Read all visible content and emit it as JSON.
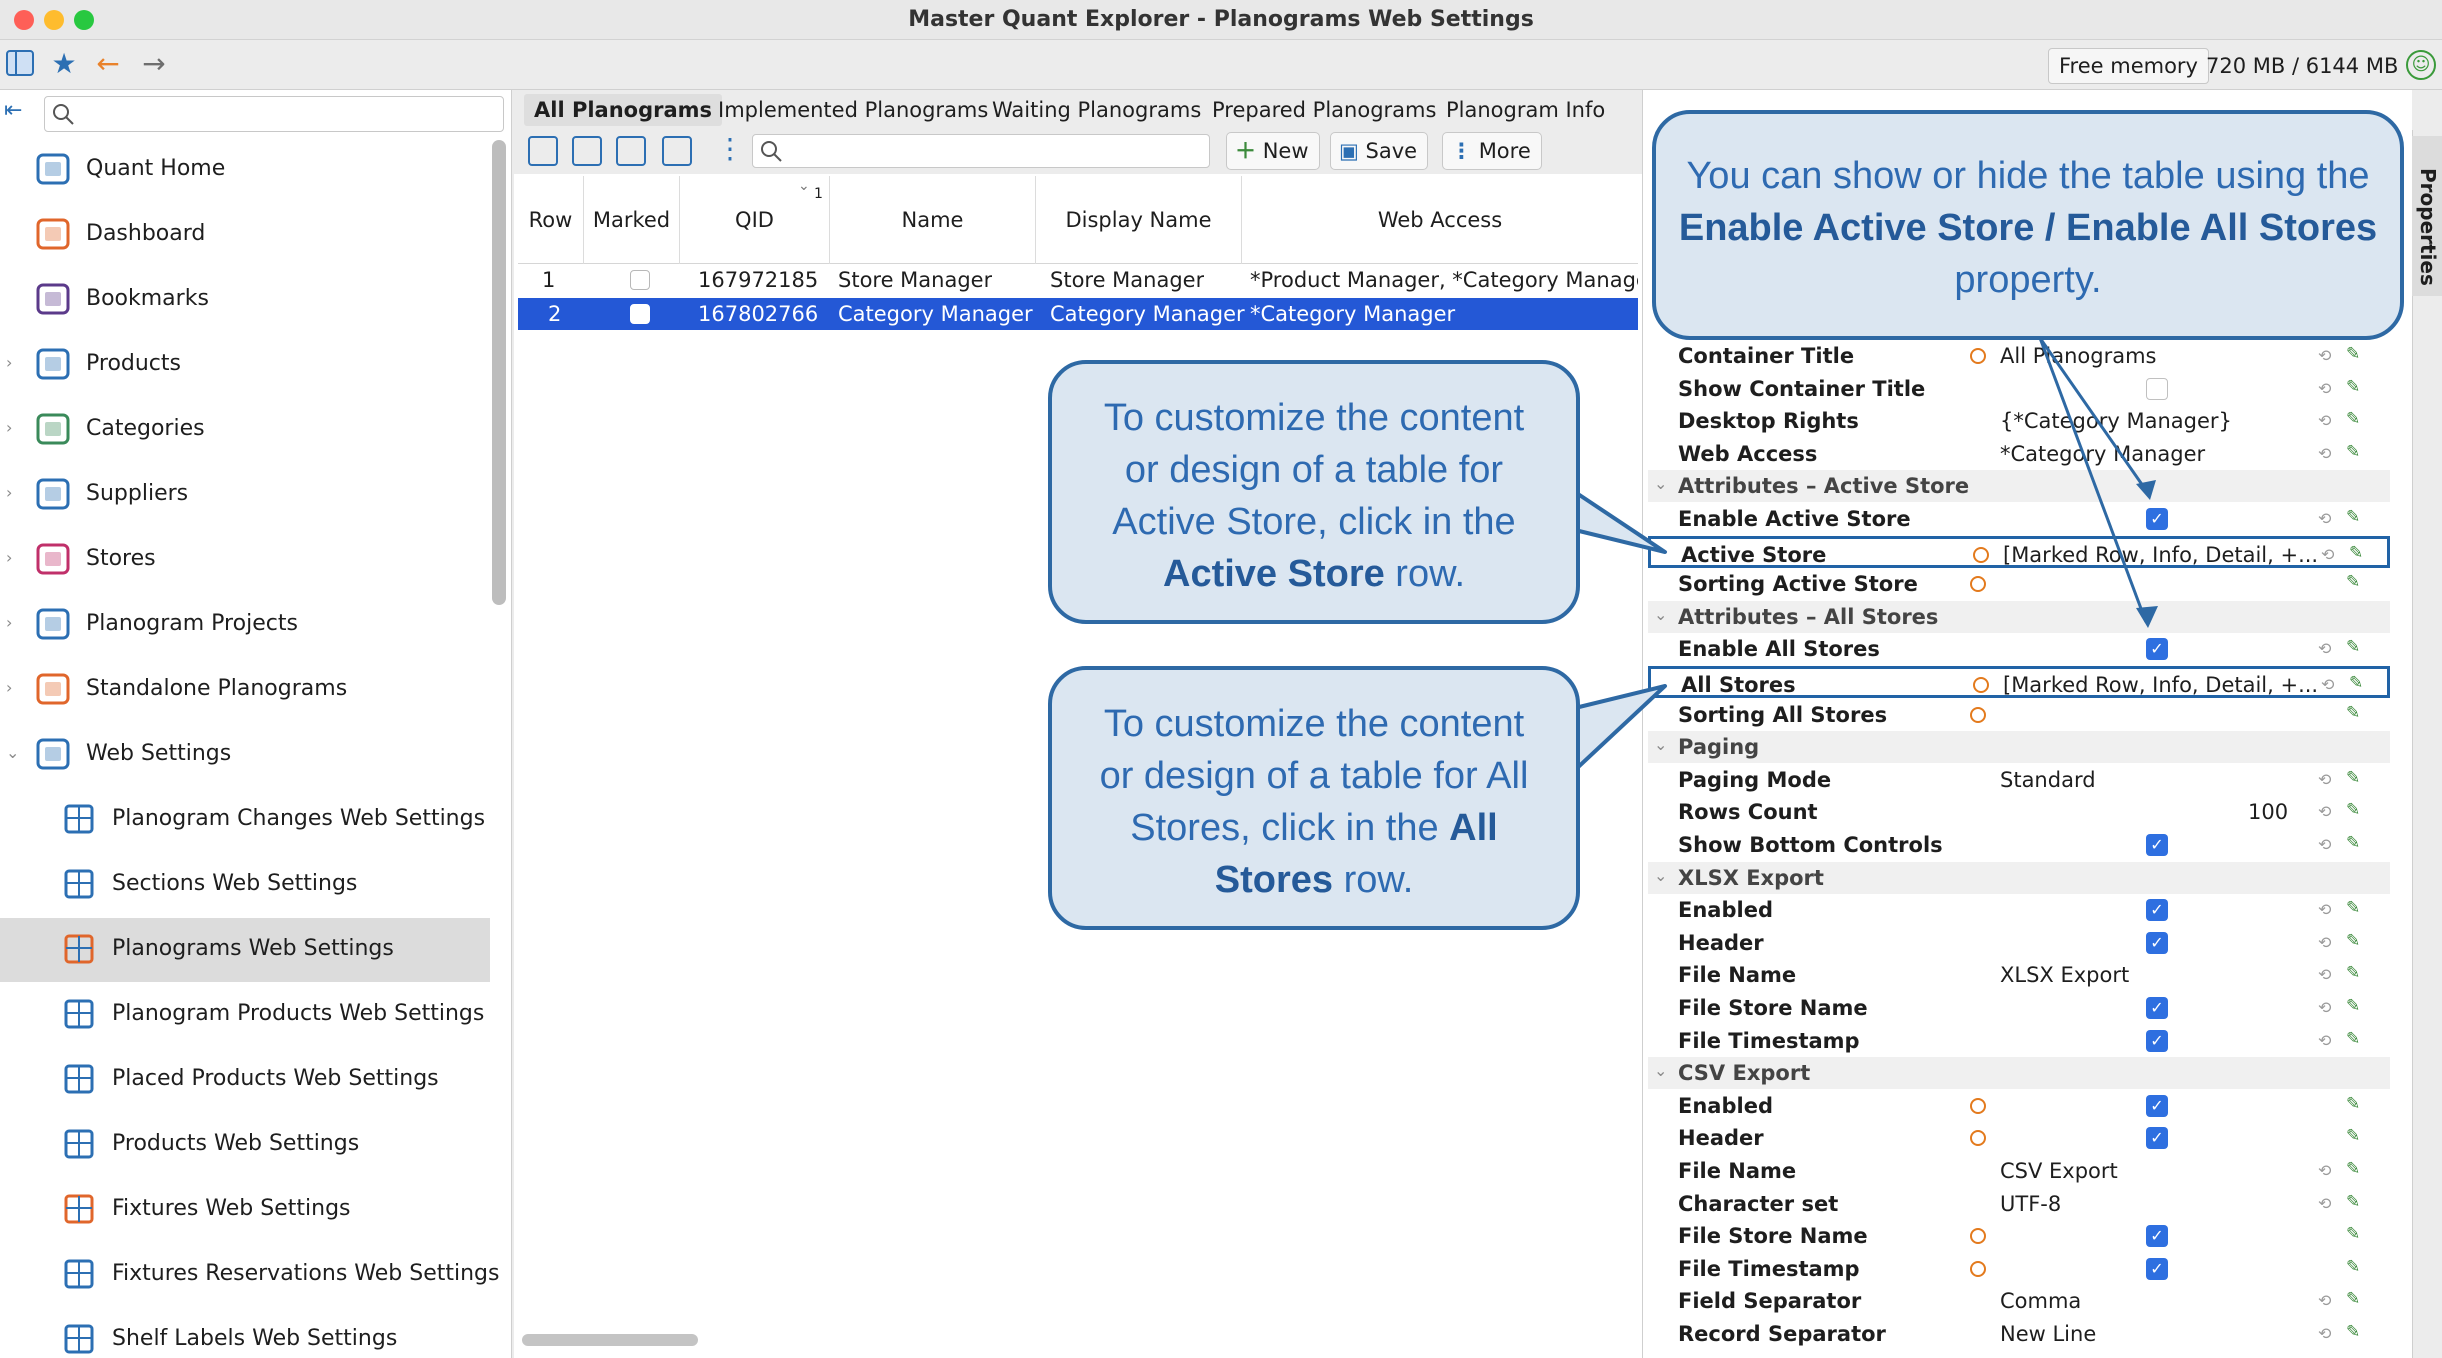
{
  "window": {
    "title": "Master Quant Explorer - Planograms Web Settings"
  },
  "status": {
    "free_memory_label": "Free memory",
    "free_memory_value": "720 MB / 6144 MB"
  },
  "nav": {
    "items": [
      {
        "label": "Quant Home"
      },
      {
        "label": "Dashboard"
      },
      {
        "label": "Bookmarks"
      },
      {
        "label": "Products"
      },
      {
        "label": "Categories"
      },
      {
        "label": "Suppliers"
      },
      {
        "label": "Stores"
      },
      {
        "label": "Planogram Projects"
      },
      {
        "label": "Standalone Planograms"
      },
      {
        "label": "Web Settings"
      }
    ],
    "sub_items": [
      {
        "label": "Planogram Changes Web Settings"
      },
      {
        "label": "Sections Web Settings"
      },
      {
        "label": "Planograms Web Settings"
      },
      {
        "label": "Planogram Products Web Settings"
      },
      {
        "label": "Placed Products Web Settings"
      },
      {
        "label": "Products Web Settings"
      },
      {
        "label": "Fixtures Web Settings"
      },
      {
        "label": "Fixtures Reservations Web Settings"
      },
      {
        "label": "Shelf Labels Web Settings"
      }
    ]
  },
  "tabs": [
    "All Planograms",
    "Implemented Planograms",
    "Waiting Planograms",
    "Prepared Planograms",
    "Planogram Info"
  ],
  "center_toolbar": {
    "new_label": "New",
    "save_label": "Save",
    "more_label": "More"
  },
  "grid": {
    "columns": [
      "Row",
      "Marked",
      "QID",
      "1",
      "Name",
      "Display Name",
      "Web Access"
    ],
    "rows": [
      {
        "row": "1",
        "qid": "167972185",
        "name": "Store Manager",
        "display_name": "Store Manager",
        "web_access": "*Product Manager, *Category Manager"
      },
      {
        "row": "2",
        "qid": "167802766",
        "name": "Category Manager",
        "display_name": "Category Manager",
        "web_access": "*Category Manager"
      }
    ]
  },
  "properties": {
    "tab_label": "Properties",
    "rows": [
      {
        "name": "Container Title",
        "value": "All Planograms"
      },
      {
        "name": "Show Container Title",
        "value": ""
      },
      {
        "name": "Desktop Rights",
        "value": "{*Category Manager}"
      },
      {
        "name": "Web Access",
        "value": "*Category Manager"
      },
      {
        "name": "Attributes – Active Store",
        "value": ""
      },
      {
        "name": "Enable Active Store",
        "value": ""
      },
      {
        "name": "Active Store",
        "value": "[Marked Row, Info, Detail, +..."
      },
      {
        "name": "Sorting Active Store",
        "value": ""
      },
      {
        "name": "Attributes – All Stores",
        "value": ""
      },
      {
        "name": "Enable All Stores",
        "value": ""
      },
      {
        "name": "All Stores",
        "value": "[Marked Row, Info, Detail, +..."
      },
      {
        "name": "Sorting All Stores",
        "value": ""
      },
      {
        "name": "Paging",
        "value": ""
      },
      {
        "name": "Paging Mode",
        "value": "Standard"
      },
      {
        "name": "Rows Count",
        "value": "100"
      },
      {
        "name": "Show Bottom Controls",
        "value": ""
      },
      {
        "name": "XLSX Export",
        "value": ""
      },
      {
        "name": "Enabled",
        "value": ""
      },
      {
        "name": "Header",
        "value": ""
      },
      {
        "name": "File Name",
        "value": "XLSX Export"
      },
      {
        "name": "File Store Name",
        "value": ""
      },
      {
        "name": "File Timestamp",
        "value": ""
      },
      {
        "name": "CSV Export",
        "value": ""
      },
      {
        "name": "Enabled",
        "value": ""
      },
      {
        "name": "Header",
        "value": ""
      },
      {
        "name": "File Name",
        "value": "CSV Export"
      },
      {
        "name": "Character set",
        "value": "UTF-8"
      },
      {
        "name": "File Store Name",
        "value": ""
      },
      {
        "name": "File Timestamp",
        "value": ""
      },
      {
        "name": "Field Separator",
        "value": "Comma"
      },
      {
        "name": "Record Separator",
        "value": "New Line"
      }
    ]
  },
  "callouts": {
    "top": {
      "pre": "You can show or hide the table using the ",
      "bold": "Enable Active Store / Enable All Stores",
      "post": " property."
    },
    "active": {
      "pre": "To customize the content or design of a table for Active Store, click in the ",
      "bold": "Active Store",
      "post": " row."
    },
    "all": {
      "pre": "To customize the content or design of a table for All Stores, click in the ",
      "bold": "All Stores",
      "post": " row."
    }
  },
  "colors": {
    "accent": "#2458d6",
    "callout_border": "#2e69a4",
    "callout_fill": "#dbe6f1",
    "callout_text": "#2e6ab1"
  }
}
